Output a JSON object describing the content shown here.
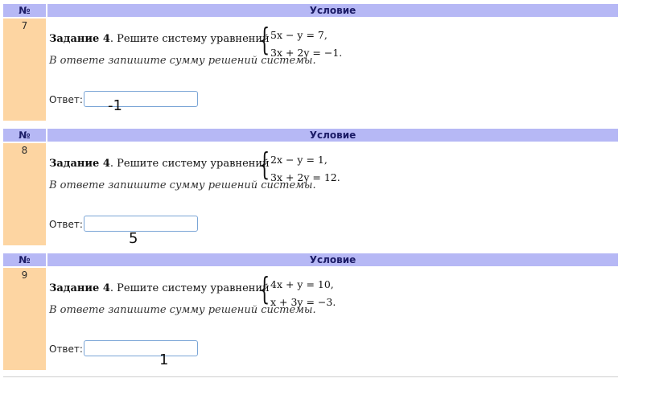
{
  "header": {
    "num_label": "№",
    "cond_label": "Условие"
  },
  "answer_label": "Ответ:",
  "tasks": [
    {
      "number": "7",
      "task_title": "Задание 4",
      "task_text": ". Решите систему уравнений",
      "eq1": "5x − y = 7,",
      "eq2": "3x + 2y = −1.",
      "note": "В ответе запишите сумму решений системы.",
      "answer": "-1"
    },
    {
      "number": "8",
      "task_title": "Задание 4",
      "task_text": ". Решите систему уравнений",
      "eq1": "2x − y = 1,",
      "eq2": "3x + 2y = 12.",
      "note": "В ответе запишите сумму решений системы.",
      "answer": "5"
    },
    {
      "number": "9",
      "task_title": "Задание 4",
      "task_text": ". Решите систему уравнений",
      "eq1": "4x + y = 10,",
      "eq2": "x + 3y = −3.",
      "note": "В ответе запишите сумму решений системы.",
      "answer": "1"
    }
  ]
}
